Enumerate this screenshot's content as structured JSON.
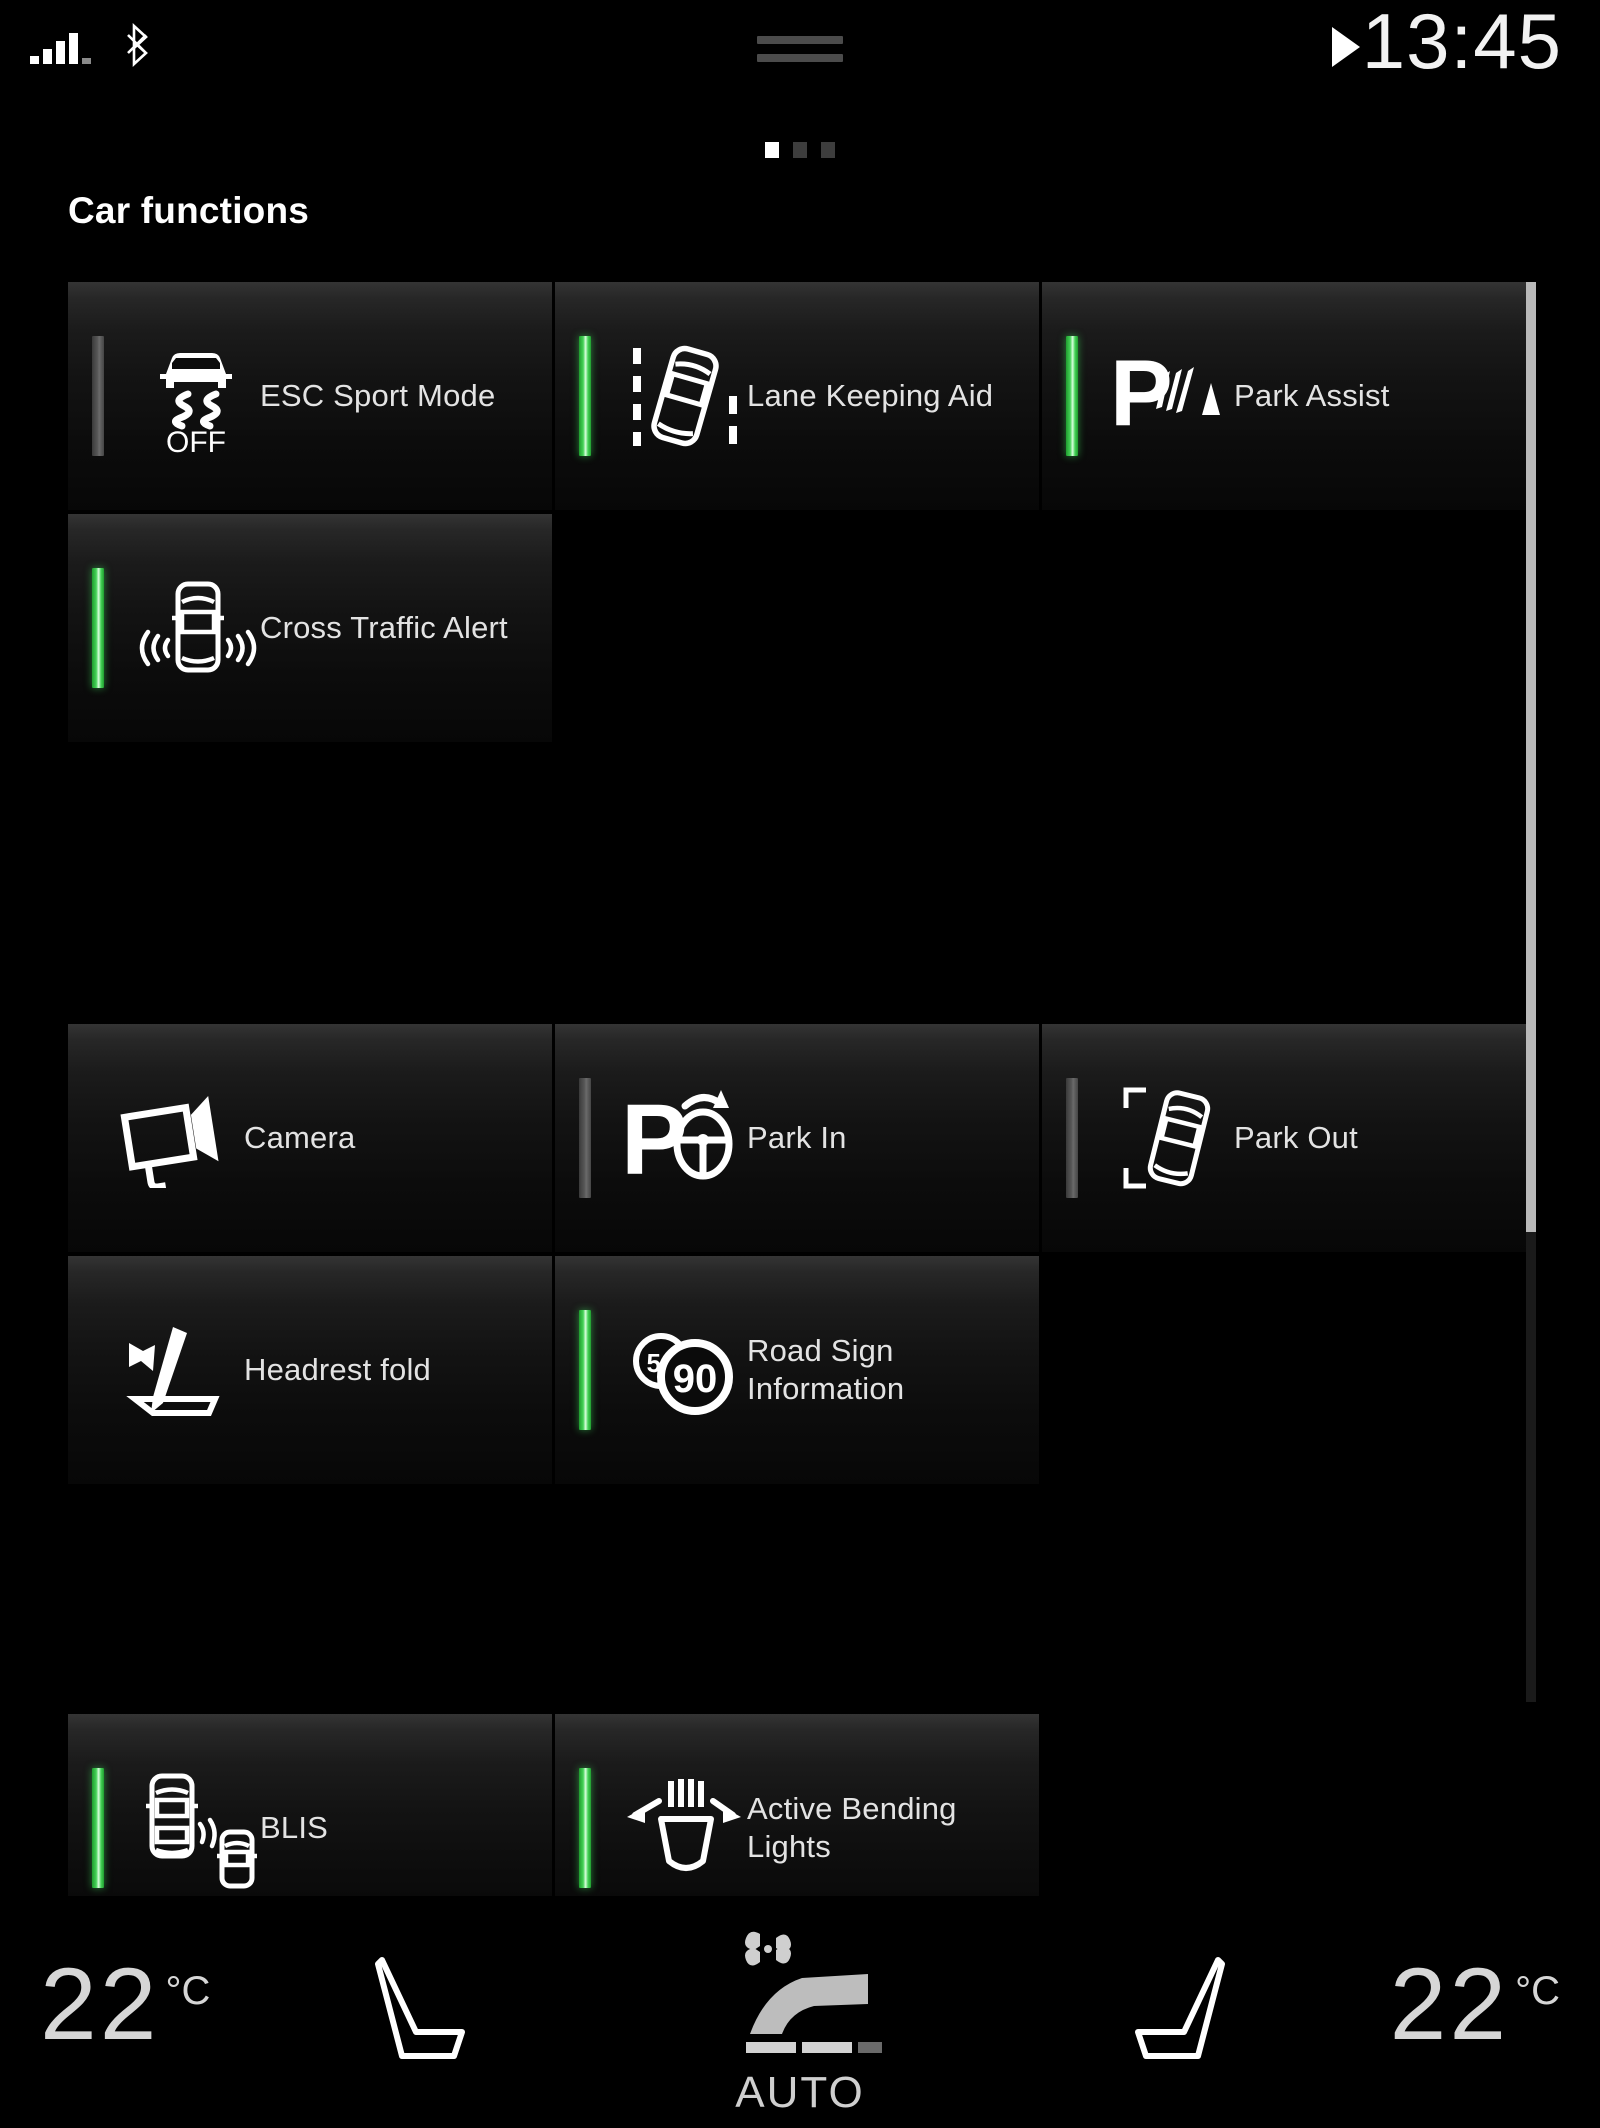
{
  "status_bar": {
    "signal_icon": "signal-bars-icon",
    "signal_strength_bars": 4,
    "bluetooth_icon": "bluetooth-icon",
    "drag_handle_icon": "drag-handle-icon",
    "media_play_icon": "play-icon",
    "time": "13:45"
  },
  "page_indicator": {
    "total_pages": 3,
    "active_page": 1
  },
  "header": {
    "title": "Car functions"
  },
  "colors": {
    "active_green": "#44d257",
    "inactive_gray": "#575757",
    "text": "#e3e3e3",
    "background": "#000000"
  },
  "grid": {
    "rows": [
      {
        "tiles": [
          {
            "label": "ESC Sport Mode",
            "icon": "esc-sport-mode-icon",
            "status": "off",
            "name": "tile-esc-sport-mode"
          },
          {
            "label": "Lane Keeping Aid",
            "icon": "lane-keeping-aid-icon",
            "status": "on",
            "name": "tile-lane-keeping-aid"
          },
          {
            "label": "Park Assist",
            "icon": "park-assist-icon",
            "status": "on",
            "name": "tile-park-assist"
          }
        ]
      },
      {
        "tiles": [
          {
            "label": "Cross Traffic Alert",
            "icon": "cross-traffic-alert-icon",
            "status": "on",
            "name": "tile-cross-traffic-alert"
          },
          {
            "label": "",
            "icon": "",
            "status": "none",
            "name": "tile-empty-1"
          },
          {
            "label": "",
            "icon": "",
            "status": "none",
            "name": "tile-empty-2"
          }
        ]
      },
      {
        "tiles": [
          {
            "label": "Camera",
            "icon": "camera-icon",
            "status": "none",
            "name": "tile-camera"
          },
          {
            "label": "Park In",
            "icon": "park-in-icon",
            "status": "off",
            "name": "tile-park-in"
          },
          {
            "label": "Park Out",
            "icon": "park-out-icon",
            "status": "off",
            "name": "tile-park-out"
          }
        ]
      },
      {
        "tiles": [
          {
            "label": "Headrest fold",
            "icon": "headrest-fold-icon",
            "status": "none",
            "name": "tile-headrest-fold"
          },
          {
            "label": "Road Sign Information",
            "icon": "road-sign-information-icon",
            "status": "on",
            "name": "tile-road-sign-information"
          },
          {
            "label": "",
            "icon": "",
            "status": "none",
            "name": "tile-empty-3"
          }
        ]
      },
      {
        "tiles": [
          {
            "label": "BLIS",
            "icon": "blis-icon",
            "status": "on",
            "name": "tile-blis"
          },
          {
            "label": "Active Bending Lights",
            "icon": "active-bending-lights-icon",
            "status": "on",
            "name": "tile-active-bending-lights"
          },
          {
            "label": "",
            "icon": "",
            "status": "none",
            "name": "tile-empty-4"
          }
        ]
      }
    ]
  },
  "road_sign": {
    "background_sign_value": "50",
    "foreground_sign_value": "90"
  },
  "esc_icon": {
    "off_text": "OFF"
  },
  "climate": {
    "left_temperature": "22",
    "left_unit": "°C",
    "right_temperature": "22",
    "right_unit": "°C",
    "left_seat_icon": "seat-heater-left-icon",
    "right_seat_icon": "seat-heater-right-icon",
    "auto_label": "AUTO",
    "auto_icon": "auto-climate-icon"
  },
  "scrollbar": {
    "name": "vertical-scrollbar"
  }
}
